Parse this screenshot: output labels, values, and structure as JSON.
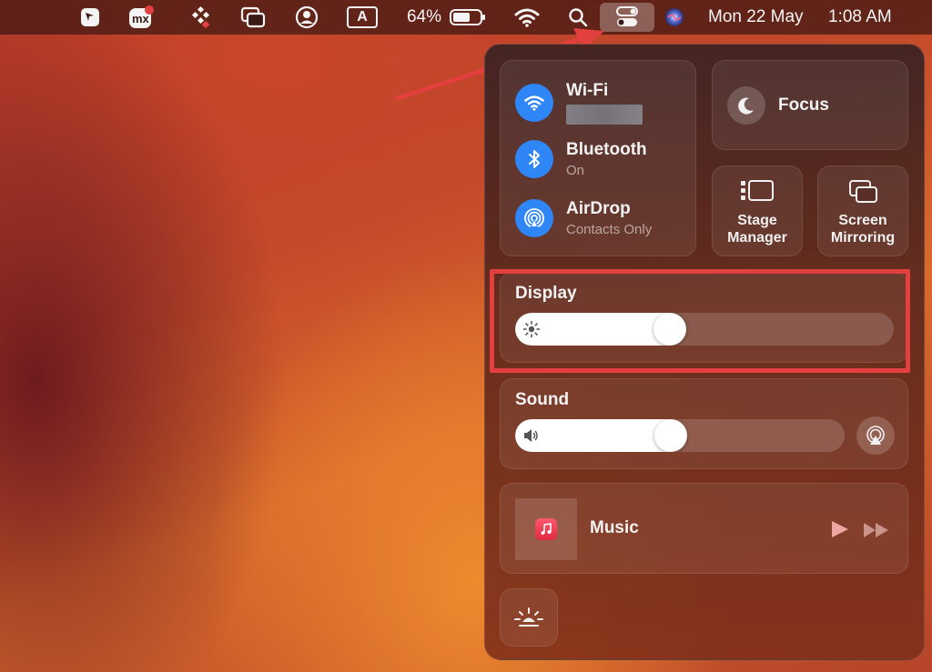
{
  "menubar": {
    "battery_percent": "64%",
    "battery_level": 0.64,
    "date": "Mon 22 May",
    "time": "1:08 AM",
    "input_source": "A",
    "icons": [
      "pen-tool-icon",
      "mx-app-icon",
      "grid-dots-icon",
      "window-stack-icon",
      "user-circle-icon",
      "input-source-icon",
      "battery-icon",
      "wifi-icon",
      "search-icon",
      "control-center-icon",
      "siri-icon"
    ]
  },
  "control_center": {
    "wifi": {
      "label": "Wi-Fi",
      "icon": "wifi-icon"
    },
    "bluetooth": {
      "label": "Bluetooth",
      "status": "On",
      "icon": "bluetooth-icon"
    },
    "airdrop": {
      "label": "AirDrop",
      "status": "Contacts Only",
      "icon": "airdrop-icon"
    },
    "focus": {
      "label": "Focus",
      "icon": "moon-icon"
    },
    "stage_manager": {
      "line1": "Stage",
      "line2": "Manager",
      "icon": "stage-manager-icon"
    },
    "screen_mirroring": {
      "line1": "Screen",
      "line2": "Mirroring",
      "icon": "screen-mirroring-icon"
    },
    "display": {
      "label": "Display",
      "brightness": 0.4,
      "icon": "sun-icon"
    },
    "sound": {
      "label": "Sound",
      "volume": 0.47,
      "icon": "speaker-icon"
    },
    "music": {
      "label": "Music",
      "icon": "music-note-icon"
    },
    "keyboard_brightness_icon": "keyboard-brightness-icon"
  },
  "colors": {
    "accent_blue": "#2f86f6",
    "annotation_red": "#e2403f"
  }
}
